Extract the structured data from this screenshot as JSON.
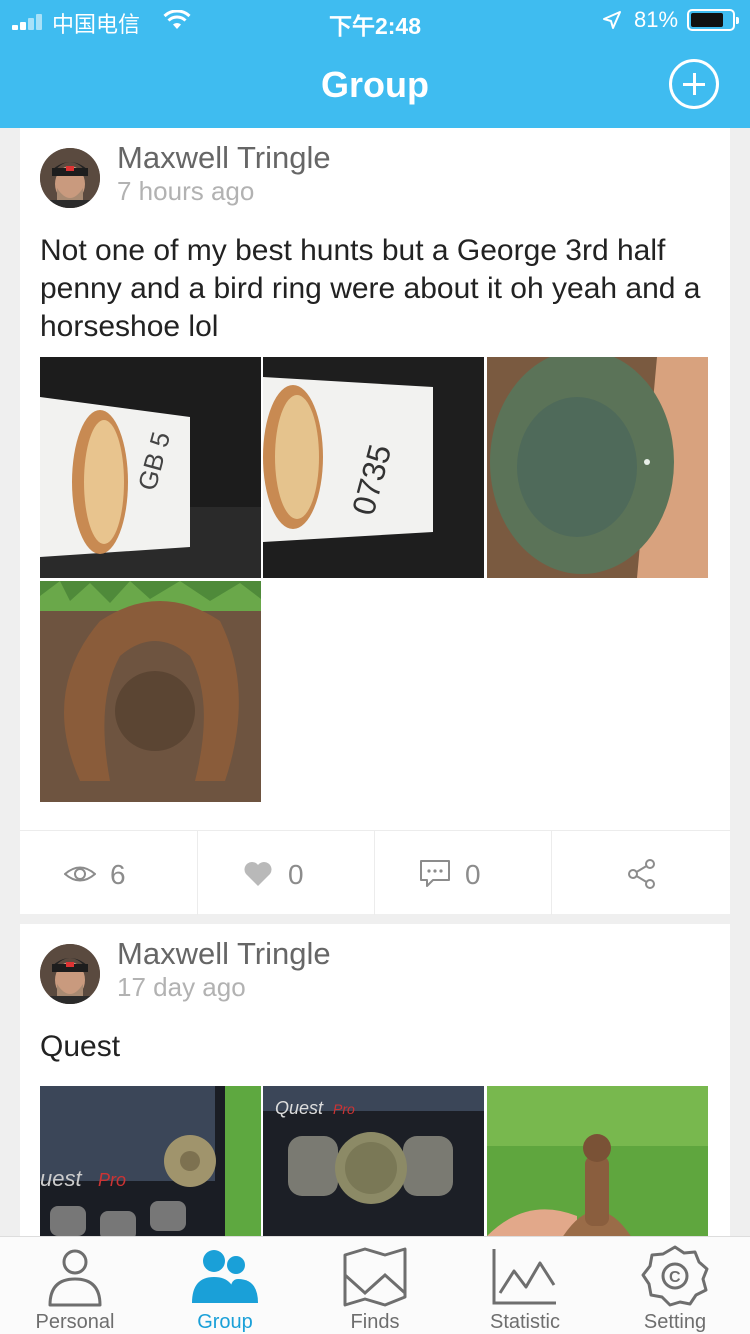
{
  "status_bar": {
    "carrier": "中国电信",
    "time": "下午2:48",
    "battery_percent": "81%",
    "battery_level": 0.81
  },
  "header": {
    "title": "Group",
    "add_icon": "plus-circle-icon"
  },
  "posts": [
    {
      "author": "Maxwell Tringle",
      "time": "7 hours ago",
      "text": "Not one of my best hunts but a George 3rd half penny and a bird ring were about it oh yeah and a horseshoe lol",
      "views": "6",
      "likes": "0",
      "comments": "0"
    },
    {
      "author": "Maxwell Tringle",
      "time": "17 day ago",
      "text": "Quest"
    }
  ],
  "tabs": [
    {
      "label": "Personal",
      "icon": "person-icon",
      "active": false
    },
    {
      "label": "Group",
      "icon": "group-icon",
      "active": true
    },
    {
      "label": "Finds",
      "icon": "finds-icon",
      "active": false
    },
    {
      "label": "Statistic",
      "icon": "chart-icon",
      "active": false
    },
    {
      "label": "Setting",
      "icon": "settings-gear-icon",
      "active": false
    }
  ],
  "colors": {
    "accent": "#3fbcf0",
    "tab_active": "#1aa0d8",
    "tab_inactive": "#6e6e6e"
  }
}
